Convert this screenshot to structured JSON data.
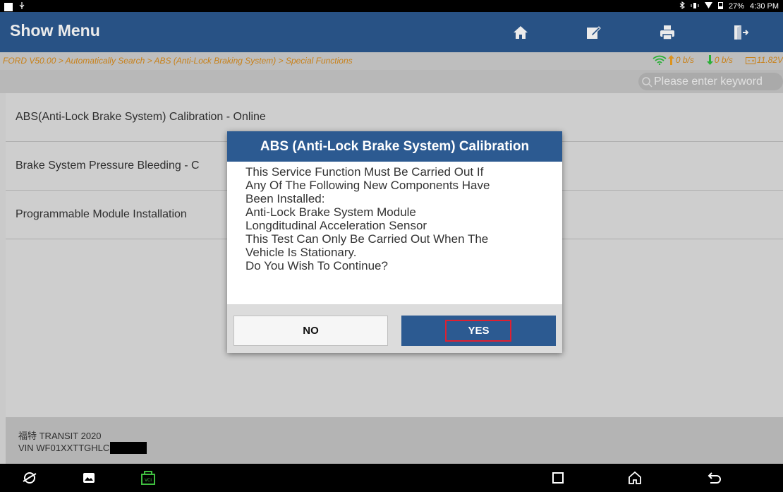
{
  "status_bar": {
    "battery": "27%",
    "time": "4:30 PM"
  },
  "header": {
    "title": "Show Menu",
    "buttons": [
      "home-icon",
      "edit-icon",
      "print-icon",
      "exit-icon"
    ]
  },
  "breadcrumb": "FORD V50.00 > Automatically Search > ABS (Anti-Lock Braking System) > Special Functions",
  "stats": {
    "upload": "0 b/s",
    "download": "0 b/s",
    "voltage": "11.82V"
  },
  "search": {
    "placeholder": "Please enter keyword"
  },
  "menu_items": [
    "ABS(Anti-Lock Brake System) Calibration - Online",
    "Brake System Pressure Bleeding - C",
    "Programmable Module Installation"
  ],
  "vehicle": {
    "name": "福特 TRANSIT 2020",
    "vin_prefix": "VIN WF01XXTTGHLC"
  },
  "dialog": {
    "title": "ABS (Anti-Lock Brake System) Calibration",
    "lines": [
      "This Service Function Must Be Carried Out If",
      "Any Of The Following New Components Have",
      "Been Installed:",
      "Anti-Lock Brake System Module",
      "Longditudinal Acceleration Sensor",
      "This Test Can Only Be Carried Out When The",
      "Vehicle Is Stationary.",
      "Do You Wish To Continue?"
    ],
    "no_label": "NO",
    "yes_label": "YES"
  },
  "colors": {
    "header_blue": "#2c5a91",
    "breadcrumb_orange": "#d98c1c",
    "highlight_red": "#e02030",
    "vci_green": "#3fbf3f"
  }
}
